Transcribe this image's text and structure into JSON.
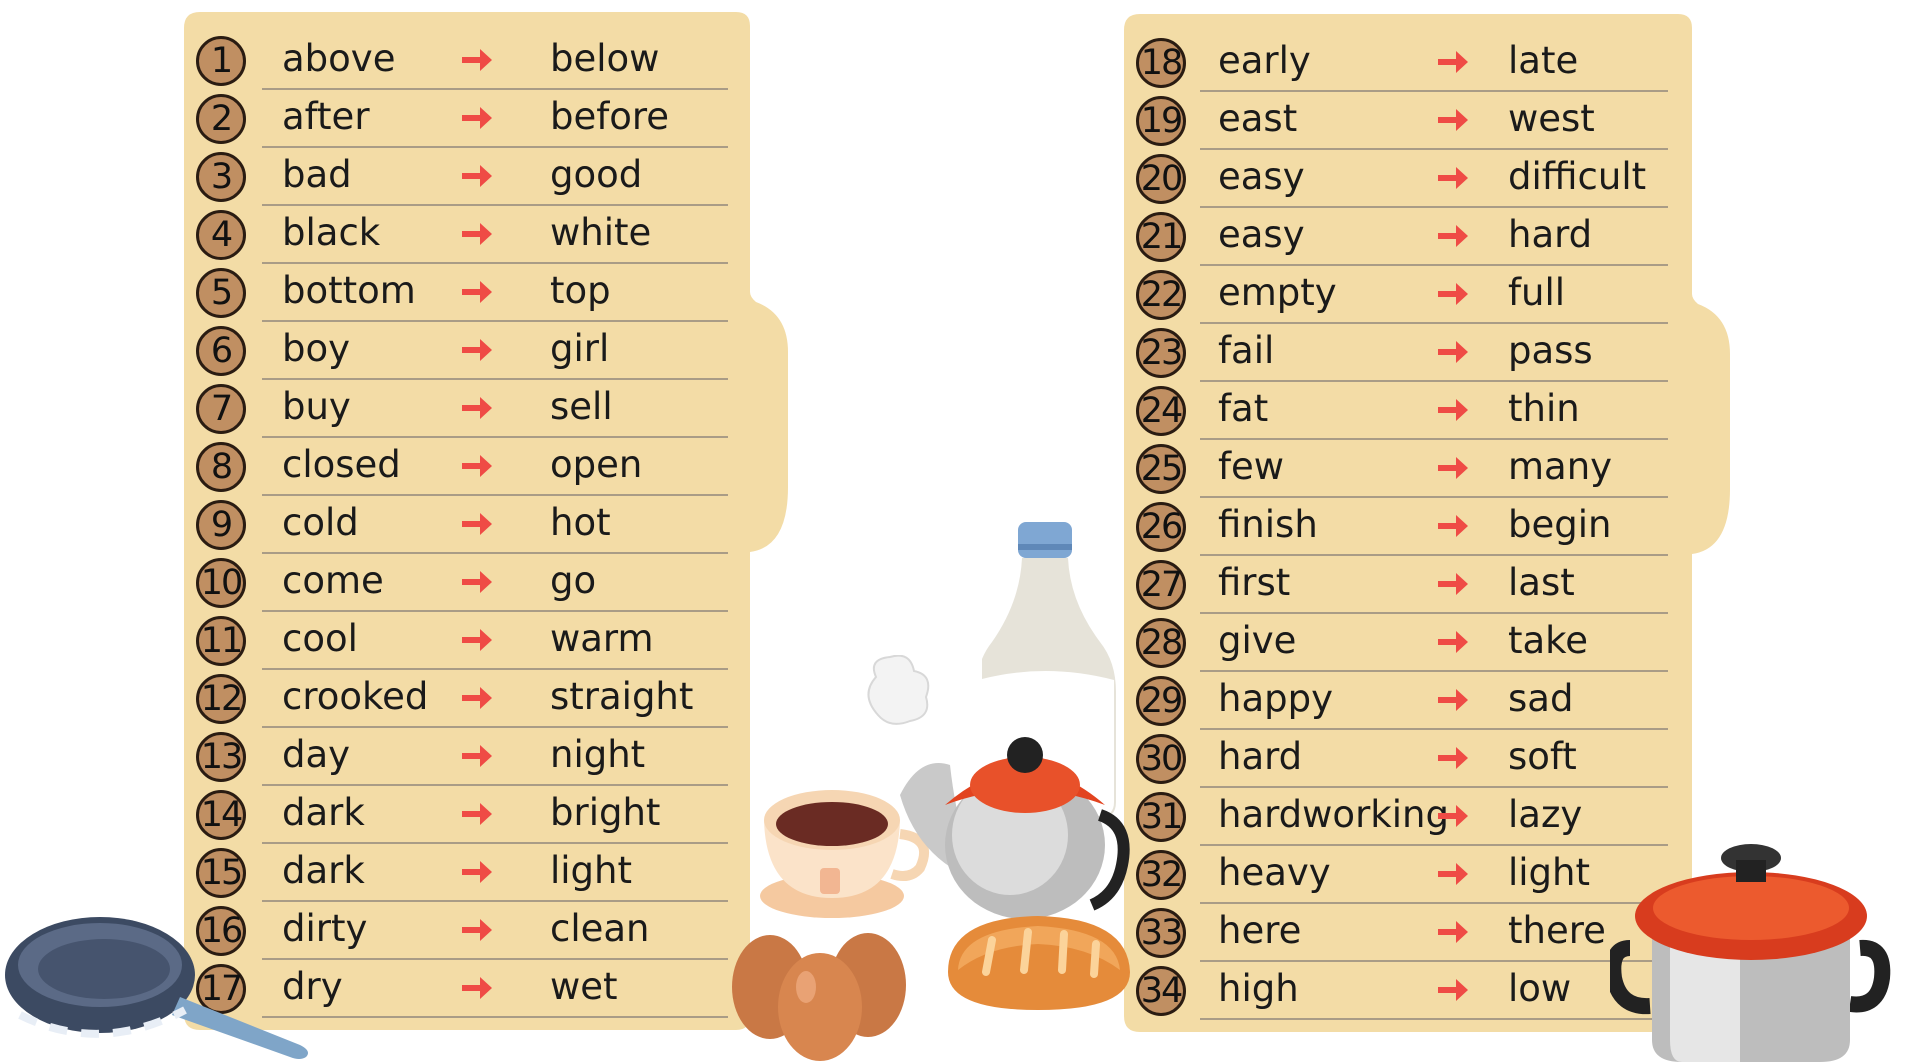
{
  "colors": {
    "panel": "#f3dca6",
    "badge": "#c08f62",
    "arrow": "#ef4b45",
    "rule": "#a99c86"
  },
  "arrow_icon": "right-arrow-icon",
  "left_list": [
    {
      "num": "1",
      "word": "above",
      "opposite": "below"
    },
    {
      "num": "2",
      "word": "after",
      "opposite": "before"
    },
    {
      "num": "3",
      "word": "bad",
      "opposite": "good"
    },
    {
      "num": "4",
      "word": "black",
      "opposite": "white"
    },
    {
      "num": "5",
      "word": "bottom",
      "opposite": "top"
    },
    {
      "num": "6",
      "word": "boy",
      "opposite": "girl"
    },
    {
      "num": "7",
      "word": "buy",
      "opposite": "sell"
    },
    {
      "num": "8",
      "word": "closed",
      "opposite": "open"
    },
    {
      "num": "9",
      "word": "cold",
      "opposite": "hot"
    },
    {
      "num": "10",
      "word": "come",
      "opposite": "go"
    },
    {
      "num": "11",
      "word": "cool",
      "opposite": "warm"
    },
    {
      "num": "12",
      "word": "crooked",
      "opposite": "straight"
    },
    {
      "num": "13",
      "word": "day",
      "opposite": "night"
    },
    {
      "num": "14",
      "word": "dark",
      "opposite": "bright"
    },
    {
      "num": "15",
      "word": "dark",
      "opposite": "light"
    },
    {
      "num": "16",
      "word": "dirty",
      "opposite": "clean"
    },
    {
      "num": "17",
      "word": "dry",
      "opposite": "wet"
    }
  ],
  "right_list": [
    {
      "num": "18",
      "word": "early",
      "opposite": "late"
    },
    {
      "num": "19",
      "word": "east",
      "opposite": "west"
    },
    {
      "num": "20",
      "word": "easy",
      "opposite": "difficult"
    },
    {
      "num": "21",
      "word": "easy",
      "opposite": "hard"
    },
    {
      "num": "22",
      "word": "empty",
      "opposite": "full"
    },
    {
      "num": "23",
      "word": "fail",
      "opposite": "pass"
    },
    {
      "num": "24",
      "word": "fat",
      "opposite": "thin"
    },
    {
      "num": "25",
      "word": "few",
      "opposite": "many"
    },
    {
      "num": "26",
      "word": "finish",
      "opposite": "begin"
    },
    {
      "num": "27",
      "word": "first",
      "opposite": "last"
    },
    {
      "num": "28",
      "word": "give",
      "opposite": "take"
    },
    {
      "num": "29",
      "word": "happy",
      "opposite": "sad"
    },
    {
      "num": "30",
      "word": "hard",
      "opposite": "soft"
    },
    {
      "num": "31",
      "word": "hardworking",
      "opposite": "lazy"
    },
    {
      "num": "32",
      "word": "heavy",
      "opposite": "light"
    },
    {
      "num": "33",
      "word": "here",
      "opposite": "there"
    },
    {
      "num": "34",
      "word": "high",
      "opposite": "low"
    }
  ],
  "illustrations": [
    "frying-pan-icon",
    "milk-bottle-icon",
    "teacup-icon",
    "teapot-icon",
    "eggs-icon",
    "bread-icon",
    "cooking-pot-icon"
  ]
}
